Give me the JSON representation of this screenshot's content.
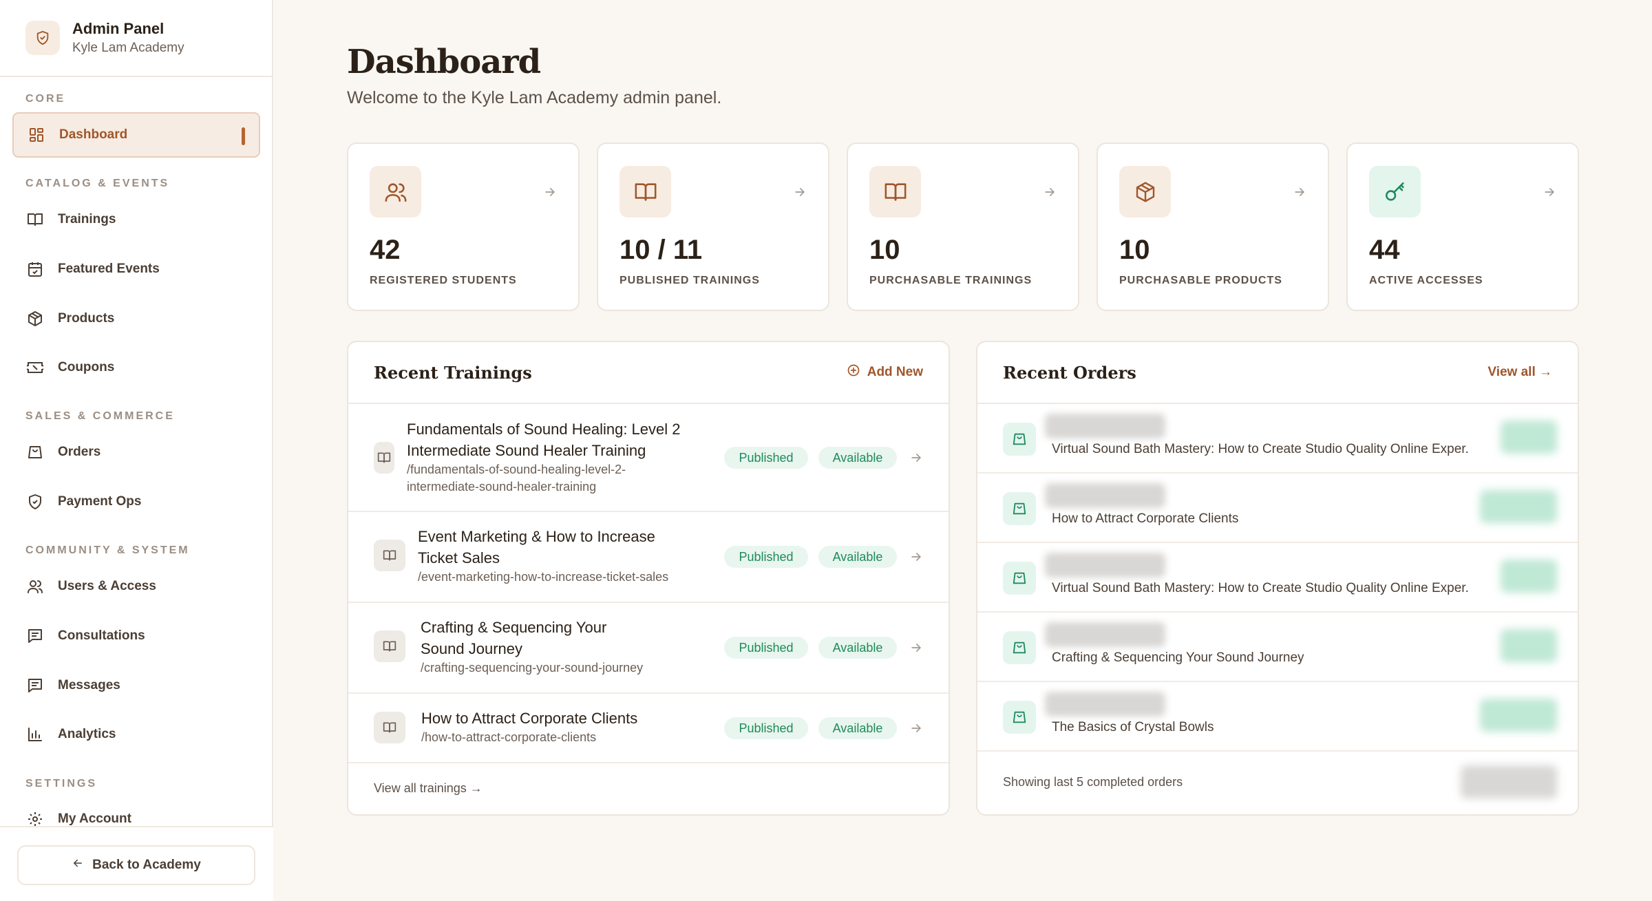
{
  "sidebar": {
    "title": "Admin Panel",
    "subtitle": "Kyle Lam Academy",
    "sections": {
      "core": "CORE",
      "catalog": "CATALOG & EVENTS",
      "sales": "SALES & COMMERCE",
      "community": "COMMUNITY & SYSTEM",
      "settings": "SETTINGS"
    },
    "items": {
      "dashboard": "Dashboard",
      "trainings": "Trainings",
      "events": "Featured Events",
      "products": "Products",
      "coupons": "Coupons",
      "orders": "Orders",
      "payment_ops": "Payment Ops",
      "users": "Users & Access",
      "consultations": "Consultations",
      "messages": "Messages",
      "analytics": "Analytics",
      "account": "My Account"
    },
    "back_label": "Back to Academy"
  },
  "header": {
    "title": "Dashboard",
    "subtitle": "Welcome to the Kyle Lam Academy admin panel."
  },
  "stats": [
    {
      "value": "42",
      "label": "REGISTERED STUDENTS",
      "icon": "users-icon"
    },
    {
      "value": "10 / 11",
      "label": "PUBLISHED TRAININGS",
      "icon": "book-icon"
    },
    {
      "value": "10",
      "label": "PURCHASABLE TRAININGS",
      "icon": "book-icon"
    },
    {
      "value": "10",
      "label": "PURCHASABLE PRODUCTS",
      "icon": "box-icon"
    },
    {
      "value": "44",
      "label": "ACTIVE ACCESSES",
      "icon": "key-icon"
    }
  ],
  "recent_trainings": {
    "title": "Recent Trainings",
    "add_label": "Add New",
    "footer_label": "View all trainings →",
    "rows": [
      {
        "title_line1": "Fundamentals of Sound Healing: Level 2",
        "title_line2": "Intermediate Sound Healer Training",
        "slug_line1": "/fundamentals-of-sound-healing-level-2-",
        "slug_line2": "intermediate-sound-healer-training",
        "status": "Published",
        "availability": "Available"
      },
      {
        "title_line1": "Event Marketing & How to Increase",
        "title_line2": "Ticket Sales",
        "slug_line1": "/event-marketing-how-to-increase-ticket-sales",
        "status": "Published",
        "availability": "Available"
      },
      {
        "title_line1": "Crafting & Sequencing Your",
        "title_line2": "Sound Journey",
        "slug_line1": "/crafting-sequencing-your-sound-journey",
        "status": "Published",
        "availability": "Available"
      },
      {
        "title_line1": "How to Attract Corporate Clients",
        "slug_line1": "/how-to-attract-corporate-clients",
        "status": "Published",
        "availability": "Available"
      }
    ]
  },
  "recent_orders": {
    "title": "Recent Orders",
    "view_all_label": "View all →",
    "footer_label": "Showing last 5 completed orders",
    "rows": [
      {
        "item": "Virtual Sound Bath Mastery: How to Create Studio Quality Online Exper."
      },
      {
        "item": "How to Attract Corporate Clients"
      },
      {
        "item": "Virtual Sound Bath Mastery: How to Create Studio Quality Online Exper."
      },
      {
        "item": "Crafting & Sequencing Your Sound Journey"
      },
      {
        "item": "The Basics of Crystal Bowls"
      }
    ]
  },
  "colors": {
    "accent": "#a0562a",
    "success": "#1f8a5a",
    "background": "#faf7f3"
  }
}
